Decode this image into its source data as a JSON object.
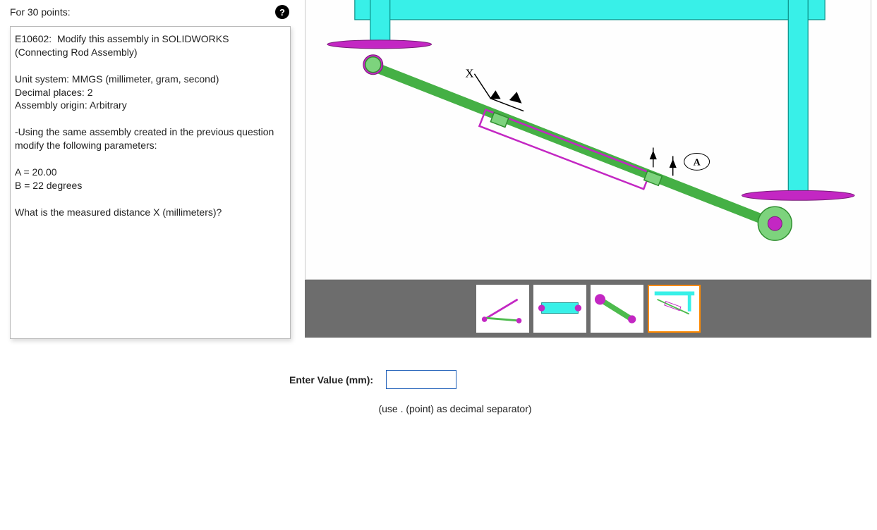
{
  "points": {
    "label": "For 30 points:"
  },
  "question": {
    "text": "E10602:  Modify this assembly in SOLIDWORKS\n(Connecting Rod Assembly)\n\nUnit system: MMGS (millimeter, gram, second)\nDecimal places: 2\nAssembly origin: Arbitrary\n\n-Using the same assembly created in the previous question modify the following parameters:\n\nA = 20.00\nB = 22 degrees\n\nWhat is the measured distance X (millimeters)?"
  },
  "figure": {
    "x_label": "X",
    "a_label": "A"
  },
  "thumbnails": {
    "count": 4,
    "selected_index": 3
  },
  "answer": {
    "label": "Enter Value (mm):",
    "value": "",
    "placeholder": "",
    "hint": "(use . (point) as decimal separator)"
  }
}
